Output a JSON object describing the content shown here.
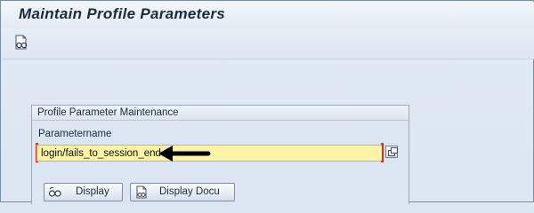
{
  "window": {
    "title": "Maintain Profile Parameters"
  },
  "toolbar": {
    "buttons": [
      {
        "icon": "display-glasses-icon"
      }
    ]
  },
  "group": {
    "title": "Profile Parameter Maintenance",
    "field_label": "Parametername",
    "field_value": "login/fails_to_session_end",
    "required": true
  },
  "buttons": {
    "display": {
      "label": "Display",
      "icon": "display-glasses-icon"
    },
    "display_docu": {
      "label": "Display Docu",
      "icon": "document-icon"
    }
  },
  "annotation": {
    "icon": "black-arrow-pointer"
  }
}
